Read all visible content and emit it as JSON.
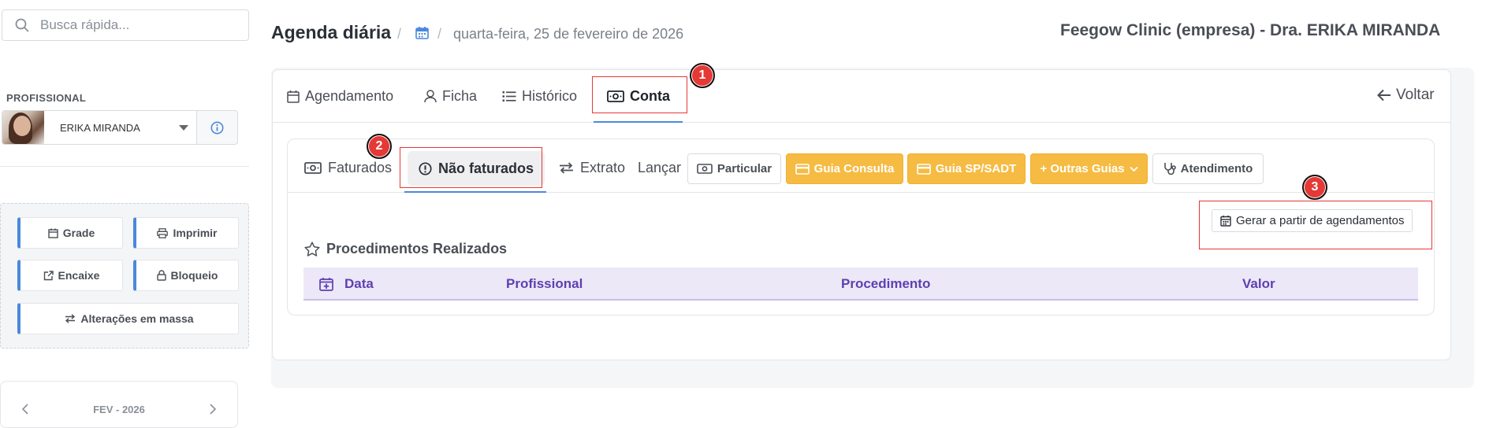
{
  "sidebar": {
    "search_placeholder": "Busca rápida...",
    "section_label": "PROFISSIONAL",
    "professional": "ERIKA MIRANDA",
    "tools": {
      "grade": "Grade",
      "imprimir": "Imprimir",
      "encaixe": "Encaixe",
      "bloqueio": "Bloqueio",
      "alteracoes": "Alterações em massa"
    },
    "calendar_month": "FEV - 2026"
  },
  "header": {
    "title": "Agenda diária",
    "separator": "/",
    "date": "quarta-feira, 25 de fevereiro de 2026",
    "company": "Feegow Clinic (empresa) - Dra. ERIKA MIRANDA"
  },
  "tabs": {
    "agendamento": "Agendamento",
    "ficha": "Ficha",
    "historico": "Histórico",
    "conta": "Conta",
    "active": "Conta",
    "voltar": "Voltar"
  },
  "account": {
    "faturados": "Faturados",
    "nao_faturados": "Não faturados",
    "extrato": "Extrato",
    "lancar": "Lançar",
    "particular": "Particular",
    "guia_consulta": "Guia Consulta",
    "guia_sp_sadt": "Guia SP/SADT",
    "outras_guias": "+ Outras Guias",
    "atendimento": "Atendimento",
    "gerar": "Gerar a partir de agendamentos",
    "section_title": "Procedimentos Realizados",
    "columns": [
      "Data",
      "Profissional",
      "Procedimento",
      "Valor"
    ]
  },
  "annotations": [
    "1",
    "2",
    "3"
  ],
  "colors": {
    "accent": "#4a89dc",
    "warning": "#f6bb42",
    "table_header_bg": "#ece8f7",
    "table_header_text": "#5e3fb0",
    "annotation_red": "#e53935"
  }
}
